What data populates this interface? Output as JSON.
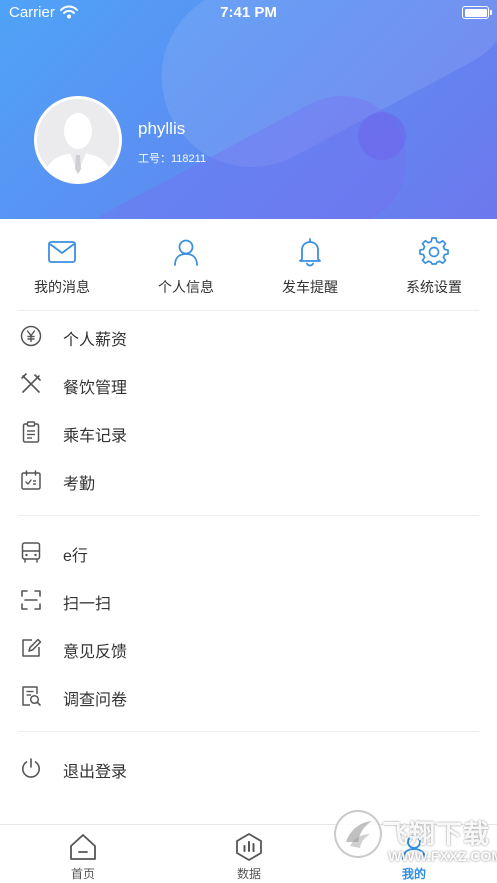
{
  "status_bar": {
    "carrier": "Carrier",
    "time": "7:41 PM"
  },
  "profile": {
    "name": "phyllis",
    "employee_id": "工号：118211"
  },
  "quick_actions": [
    {
      "label": "我的消息",
      "icon": "mail-icon"
    },
    {
      "label": "个人信息",
      "icon": "person-icon"
    },
    {
      "label": "发车提醒",
      "icon": "bell-icon"
    },
    {
      "label": "系统设置",
      "icon": "gear-icon"
    }
  ],
  "menu_group_1": [
    {
      "label": "个人薪资",
      "icon": "yen-icon"
    },
    {
      "label": "餐饮管理",
      "icon": "utensils-icon"
    },
    {
      "label": "乘车记录",
      "icon": "clipboard-icon"
    },
    {
      "label": "考勤",
      "icon": "calendar-icon"
    }
  ],
  "menu_group_2": [
    {
      "label": "e行",
      "icon": "bus-icon"
    },
    {
      "label": "扫一扫",
      "icon": "scan-icon"
    },
    {
      "label": "意见反馈",
      "icon": "edit-icon"
    },
    {
      "label": "调查问卷",
      "icon": "survey-icon"
    }
  ],
  "menu_group_3": [
    {
      "label": "退出登录",
      "icon": "power-icon"
    }
  ],
  "tab_bar": [
    {
      "label": "首页",
      "icon": "home-icon"
    },
    {
      "label": "数据",
      "icon": "chart-icon"
    },
    {
      "label": "我的",
      "icon": "user-icon",
      "active": true
    }
  ],
  "watermark": {
    "title": "飞翔下载",
    "url": "WWW.FXXZ.COM"
  },
  "colors": {
    "accent": "#2f8ee8",
    "header_start": "#4fa3f7",
    "header_end": "#6d78ee",
    "icon_blue": "#3a8fe0",
    "icon_gray": "#555555"
  }
}
